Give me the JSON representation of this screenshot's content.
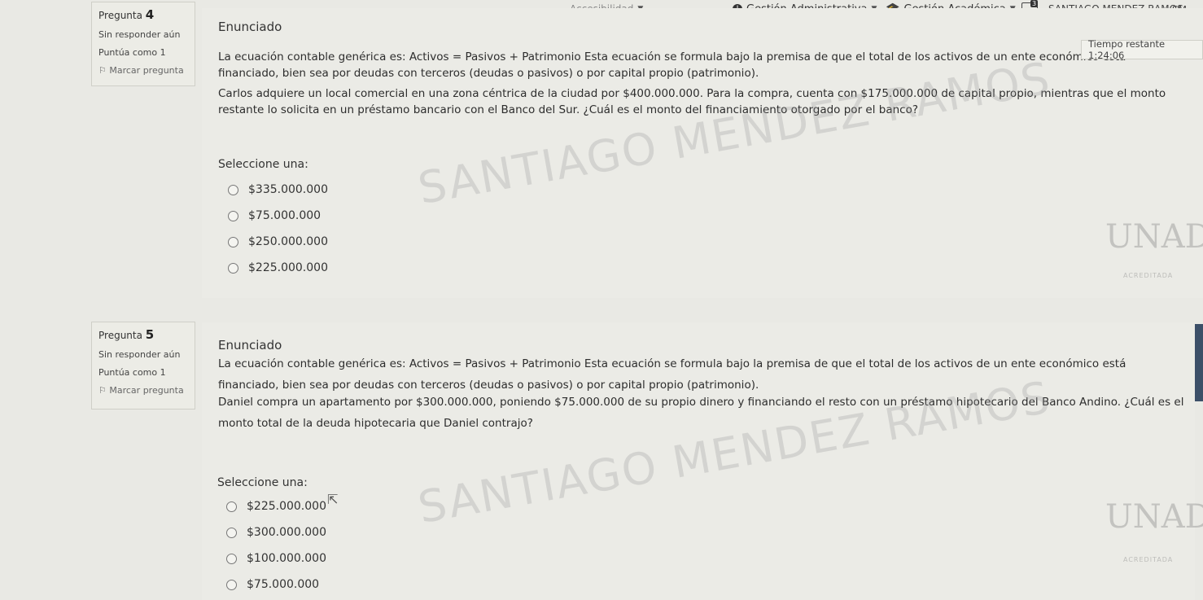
{
  "topbar": {
    "partial_item": "Accesibilidad",
    "admin_label": "Gestión Administrativa",
    "academic_label": "Gestión Académica",
    "notification_count": "3",
    "user_name": "SANTIAGO MENDEZ RAMOS",
    "user_initials": "SM"
  },
  "timer": "Tiempo restante 1:24:06",
  "watermark": "SANTIAGO MENDEZ RAMOS",
  "logo": {
    "mark": "UNAD",
    "sub": "ACREDITADA"
  },
  "questions": [
    {
      "label": "Pregunta",
      "number": "4",
      "status": "Sin responder aún",
      "score": "Puntúa como 1",
      "flag": "Marcar pregunta",
      "heading": "Enunciado",
      "text1": "La ecuación contable genérica es: Activos = Pasivos + Patrimonio Esta ecuación se formula bajo la premisa de que el total de los activos de un ente económico está financiado, bien sea por deudas con terceros (deudas o pasivos) o por capital propio (patrimonio).",
      "text2": "Carlos adquiere un local comercial en una zona céntrica de la ciudad por $400.000.000. Para la compra, cuenta con $175.000.000 de capital propio, mientras que el monto restante lo solicita en un préstamo bancario con el Banco del Sur. ¿Cuál es el monto del financiamiento otorgado por el banco?",
      "select_label": "Seleccione una:",
      "options": [
        "$335.000.000",
        "$75.000.000",
        "$250.000.000",
        "$225.000.000"
      ]
    },
    {
      "label": "Pregunta",
      "number": "5",
      "status": "Sin responder aún",
      "score": "Puntúa como 1",
      "flag": "Marcar pregunta",
      "heading": "Enunciado",
      "text1": "La ecuación contable genérica es: Activos = Pasivos + Patrimonio Esta ecuación se formula bajo la premisa de que el total de los activos de un ente económico está financiado, bien sea por deudas con terceros (deudas o pasivos) o por capital propio (patrimonio).",
      "text2": "Daniel compra un apartamento por $300.000.000, poniendo $75.000.000 de su propio dinero y financiando el resto con un préstamo hipotecario del Banco Andino. ¿Cuál es el monto total de la deuda hipotecaria que Daniel contrajo?",
      "select_label": "Seleccione una:",
      "options": [
        "$225.000.000",
        "$300.000.000",
        "$100.000.000",
        "$75.000.000"
      ]
    }
  ]
}
